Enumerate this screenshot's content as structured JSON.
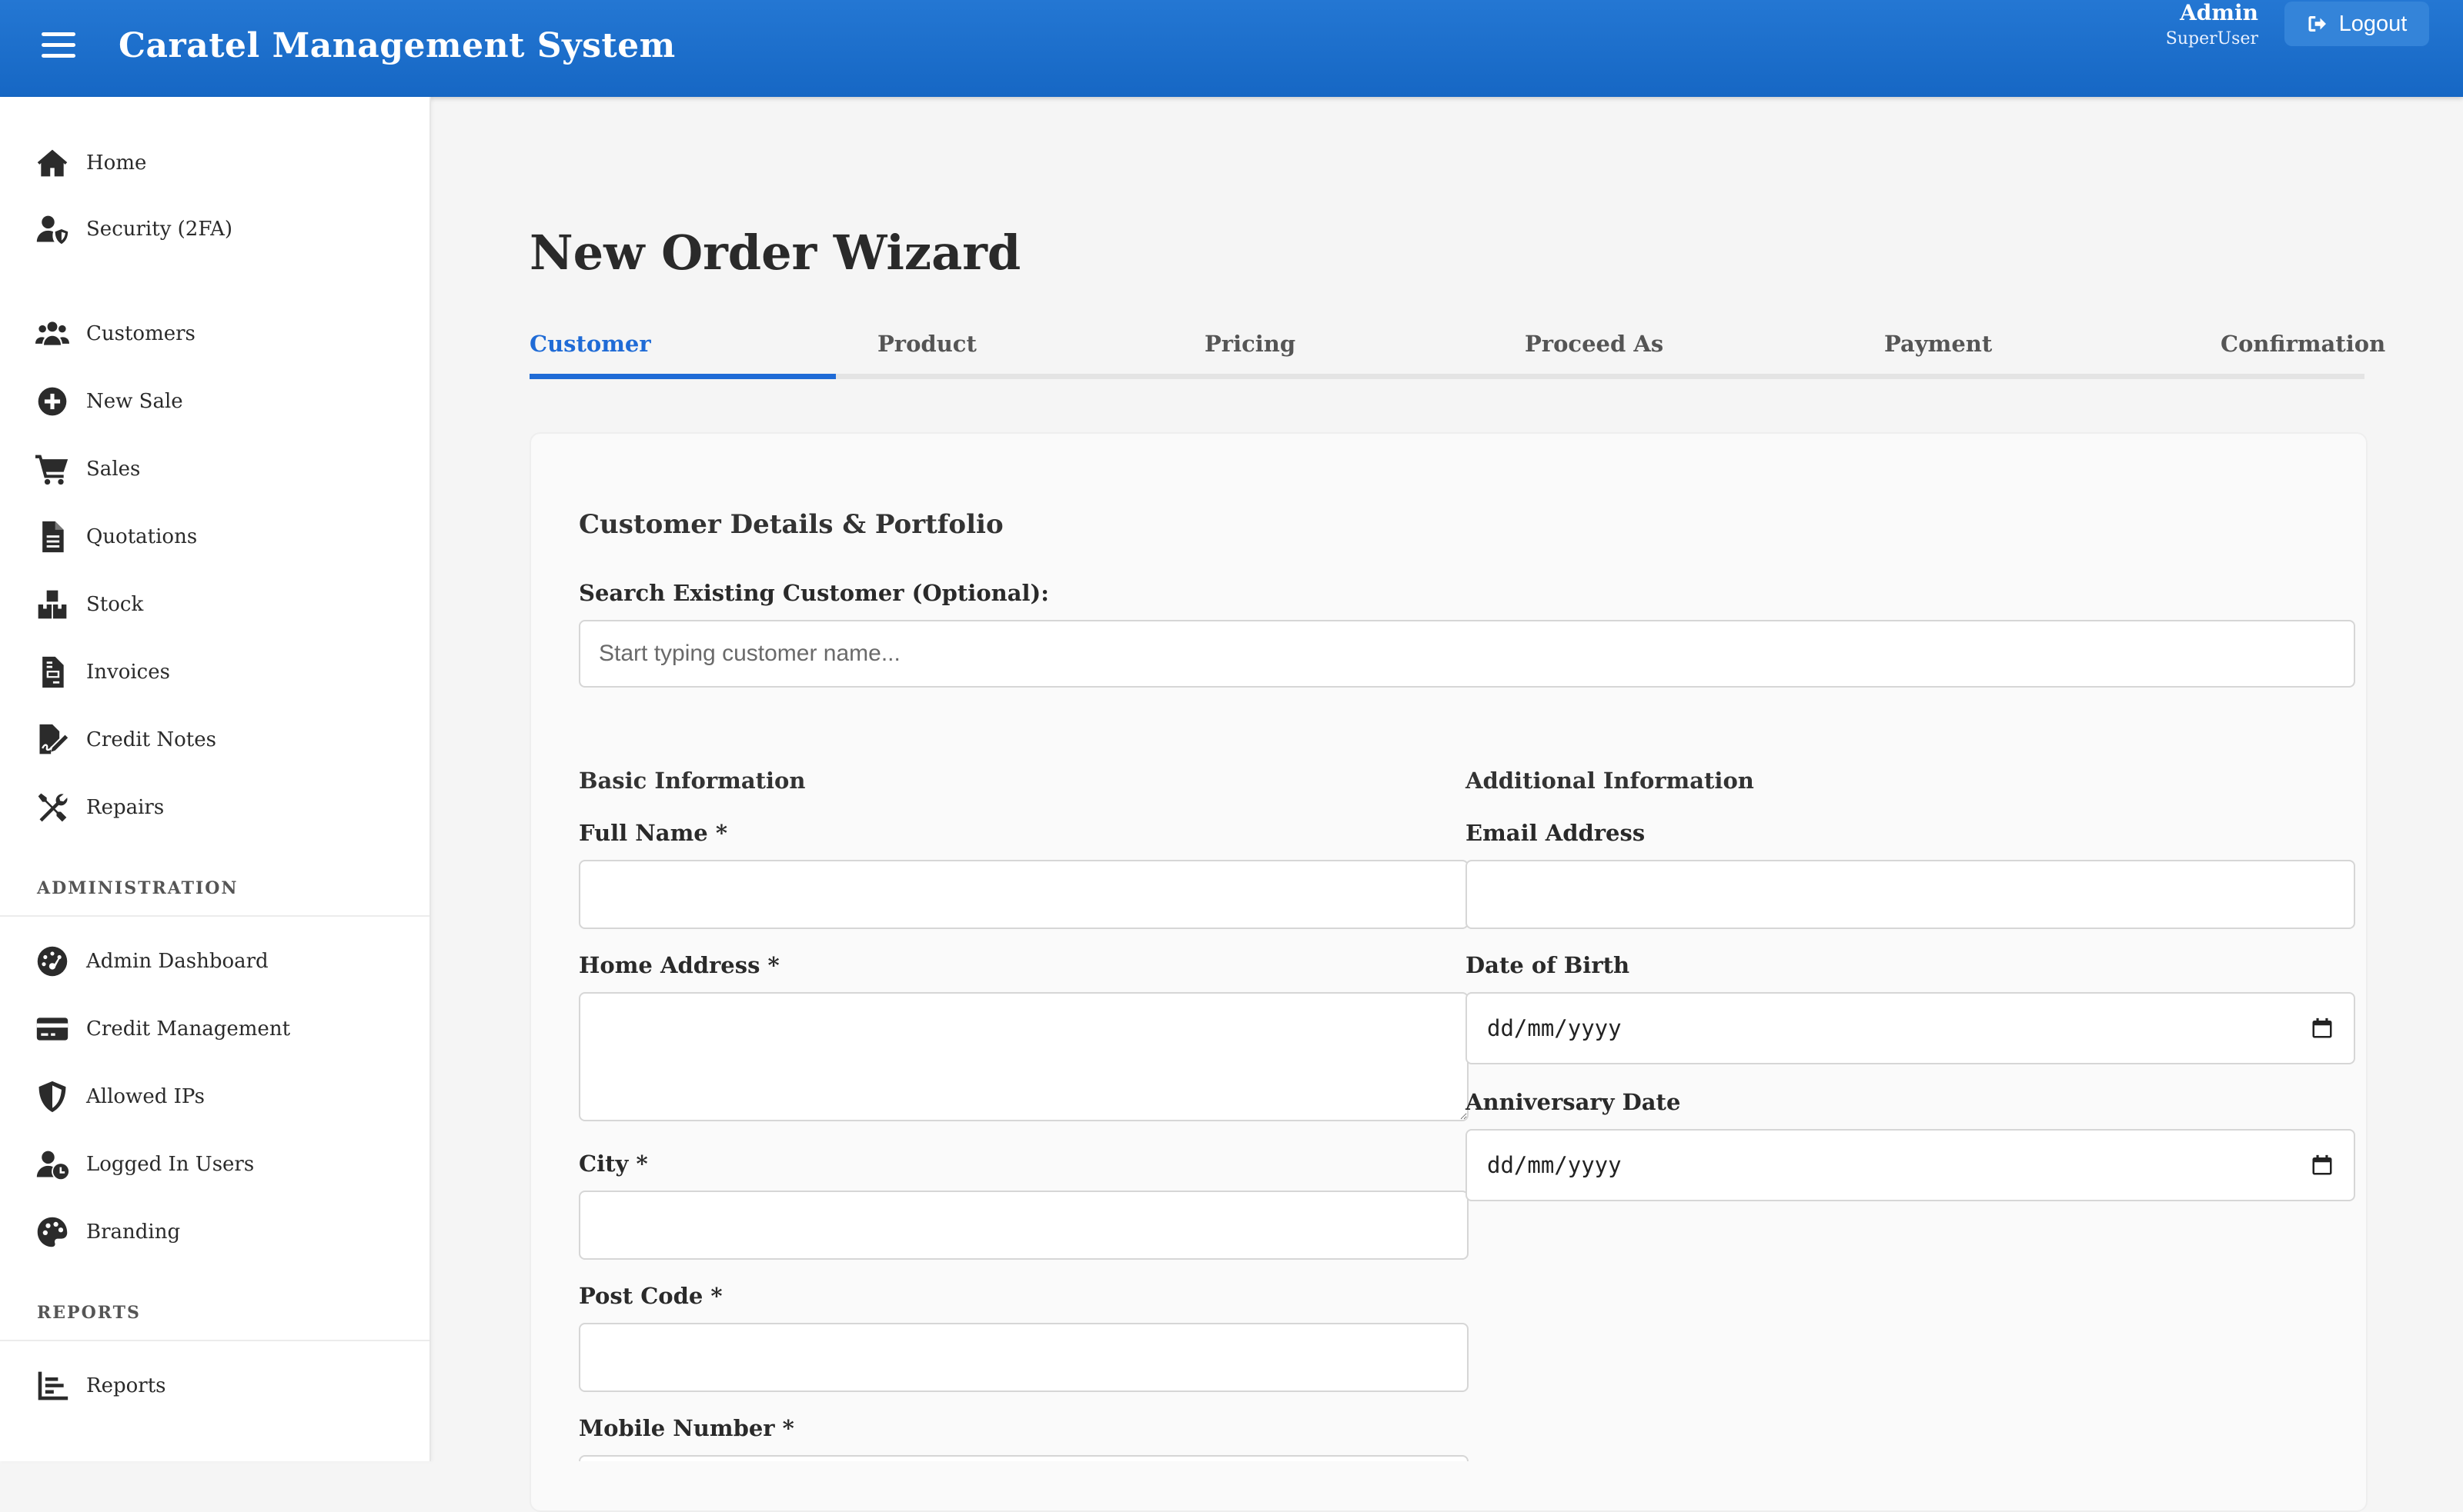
{
  "header": {
    "app_title": "Caratel Management System",
    "user_name": "Admin",
    "user_role": "SuperUser",
    "logout_label": "Logout",
    "brand_color": "#1a6fcf"
  },
  "sidebar": {
    "items": [
      {
        "label": "Home",
        "icon": "home-icon"
      },
      {
        "label": "Security (2FA)",
        "icon": "user-shield-icon"
      },
      {
        "label": "Customers",
        "icon": "users-icon"
      },
      {
        "label": "New Sale",
        "icon": "plus-circle-icon"
      },
      {
        "label": "Sales",
        "icon": "cart-icon"
      },
      {
        "label": "Quotations",
        "icon": "document-icon"
      },
      {
        "label": "Stock",
        "icon": "boxes-icon"
      },
      {
        "label": "Invoices",
        "icon": "invoice-icon"
      },
      {
        "label": "Credit Notes",
        "icon": "signature-icon"
      },
      {
        "label": "Repairs",
        "icon": "tools-icon"
      }
    ],
    "administration_title": "ADMINISTRATION",
    "admin_items": [
      {
        "label": "Admin Dashboard",
        "icon": "dashboard-icon"
      },
      {
        "label": "Credit Management",
        "icon": "credit-card-icon"
      },
      {
        "label": "Allowed IPs",
        "icon": "shield-icon"
      },
      {
        "label": "Logged In Users",
        "icon": "user-clock-icon"
      },
      {
        "label": "Branding",
        "icon": "palette-icon"
      }
    ],
    "reports_title": "REPORTS",
    "report_items": [
      {
        "label": "Reports",
        "icon": "chart-bar-icon"
      }
    ]
  },
  "main": {
    "title": "New Order Wizard",
    "steps": [
      "Customer",
      "Product",
      "Pricing",
      "Proceed As",
      "Payment",
      "Confirmation"
    ],
    "active_step": "Customer",
    "accent_color": "#1f6bd6",
    "card_title": "Customer Details & Portfolio",
    "search": {
      "label": "Search Existing Customer (Optional):",
      "placeholder": "Start typing customer name...",
      "value": ""
    },
    "basic_info": {
      "title": "Basic Information",
      "full_name_label": "Full Name *",
      "home_address_label": "Home Address *",
      "city_label": "City *",
      "post_code_label": "Post Code *",
      "mobile_label": "Mobile Number *"
    },
    "additional_info": {
      "title": "Additional Information",
      "email_label": "Email Address",
      "dob_label": "Date of Birth",
      "dob_value": "dd/mm/yyyy",
      "anniversary_label": "Anniversary Date",
      "anniversary_value": "dd/mm/yyyy"
    }
  }
}
